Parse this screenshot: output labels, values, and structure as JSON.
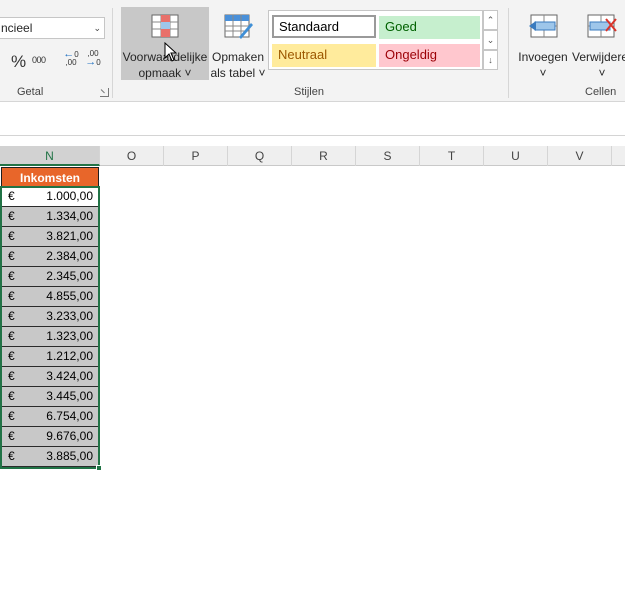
{
  "ribbon": {
    "number_format": {
      "value": "ncieel"
    },
    "number_group": {
      "percent_label": "%",
      "thousands_label": "000",
      "increase_decimal": "←0 ,00",
      "decrease_decimal": ",00 →0",
      "group_label": "Getal"
    },
    "styles_group": {
      "conditional_formatting": {
        "line1": "Voorwaardelijke",
        "line2": "opmaak ˅"
      },
      "format_as_table": {
        "line1": "Opmaken",
        "line2": "als tabel ˅"
      },
      "gallery": {
        "standaard": "Standaard",
        "goed": "Goed",
        "neutraal": "Neutraal",
        "ongeldig": "Ongeldig"
      },
      "group_label": "Stijlen"
    },
    "cells_group": {
      "insert": {
        "line1": "Invoegen",
        "line2": "˅"
      },
      "delete": {
        "line1": "Verwijderen",
        "line2": "˅"
      },
      "group_label": "Cellen"
    }
  },
  "columns": [
    "N",
    "O",
    "P",
    "Q",
    "R",
    "S",
    "T",
    "U",
    "V"
  ],
  "selected_column": "N",
  "table": {
    "header": "Inkomsten",
    "currency": "€",
    "values": [
      "1.000,00",
      "1.334,00",
      "3.821,00",
      "2.384,00",
      "2.345,00",
      "4.855,00",
      "3.233,00",
      "1.323,00",
      "1.212,00",
      "3.424,00",
      "3.445,00",
      "6.754,00",
      "9.676,00",
      "3.885,00"
    ]
  },
  "colors": {
    "header_fill": "#e8662a",
    "selection": "#217346",
    "cell_fill": "#c8c8c8"
  }
}
